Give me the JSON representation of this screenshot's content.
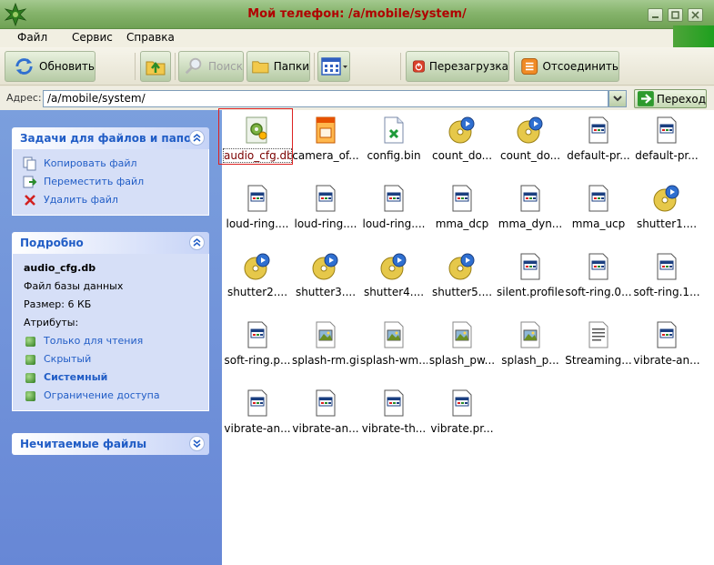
{
  "window": {
    "title": "Мой телефон: /a/mobile/system/"
  },
  "menu": [
    "Файл",
    "Сервис",
    "Справка"
  ],
  "toolbar": {
    "refresh": "Обновить",
    "search": "Поиск",
    "folders": "Папки",
    "reboot": "Перезагрузка",
    "disconnect": "Отсоединить"
  },
  "address": {
    "label": "Адрес:",
    "value": "/a/mobile/system/",
    "go": "Переход"
  },
  "tasks_panel": {
    "title": "Задачи для файлов и папок",
    "items": [
      "Копировать файл",
      "Переместить файл",
      "Удалить файл"
    ]
  },
  "details_panel": {
    "title": "Подробно",
    "filename": "audio_cfg.db",
    "type": "Файл базы данных",
    "size": "Размер: 6 КБ",
    "attributes_label": "Атрибуты:",
    "attributes": [
      "Только для чтения",
      "Скрытый",
      "Системный",
      "Ограничение доступа"
    ]
  },
  "unreadable_panel": {
    "title": "Нечитаемые файлы"
  },
  "files": [
    {
      "name": "audio_cfg.db",
      "icon": "db-gear-icon",
      "selected": true
    },
    {
      "name": "camera_of...",
      "icon": "mp3-icon"
    },
    {
      "name": "config.bin",
      "icon": "bin-icon"
    },
    {
      "name": "count_do...",
      "icon": "sound-disc-icon"
    },
    {
      "name": "count_do...",
      "icon": "sound-disc-icon"
    },
    {
      "name": "default-pr...",
      "icon": "window-file-icon"
    },
    {
      "name": "default-pr...",
      "icon": "window-file-icon"
    },
    {
      "name": "loud-ring....",
      "icon": "window-file-icon"
    },
    {
      "name": "loud-ring....",
      "icon": "window-file-icon"
    },
    {
      "name": "loud-ring....",
      "icon": "window-file-icon"
    },
    {
      "name": "mma_dcp",
      "icon": "window-file-icon"
    },
    {
      "name": "mma_dyn...",
      "icon": "window-file-icon"
    },
    {
      "name": "mma_ucp",
      "icon": "window-file-icon"
    },
    {
      "name": "shutter1....",
      "icon": "sound-disc-icon"
    },
    {
      "name": "shutter2....",
      "icon": "sound-disc-icon"
    },
    {
      "name": "shutter3....",
      "icon": "sound-disc-icon"
    },
    {
      "name": "shutter4....",
      "icon": "sound-disc-icon"
    },
    {
      "name": "shutter5....",
      "icon": "sound-disc-icon"
    },
    {
      "name": "silent.profile",
      "icon": "window-file-icon"
    },
    {
      "name": "soft-ring.0...",
      "icon": "window-file-icon"
    },
    {
      "name": "soft-ring.1...",
      "icon": "window-file-icon"
    },
    {
      "name": "soft-ring.p...",
      "icon": "window-file-icon"
    },
    {
      "name": "splash-rm.gif",
      "icon": "image-file-icon"
    },
    {
      "name": "splash-wm...",
      "icon": "image-file-icon"
    },
    {
      "name": "splash_pw...",
      "icon": "image-file-icon"
    },
    {
      "name": "splash_p...",
      "icon": "image-file-icon"
    },
    {
      "name": "Streaming...",
      "icon": "text-file-icon"
    },
    {
      "name": "vibrate-an...",
      "icon": "window-file-icon"
    },
    {
      "name": "vibrate-an...",
      "icon": "window-file-icon"
    },
    {
      "name": "vibrate-an...",
      "icon": "window-file-icon"
    },
    {
      "name": "vibrate-th...",
      "icon": "window-file-icon"
    },
    {
      "name": "vibrate.pr...",
      "icon": "window-file-icon"
    }
  ]
}
